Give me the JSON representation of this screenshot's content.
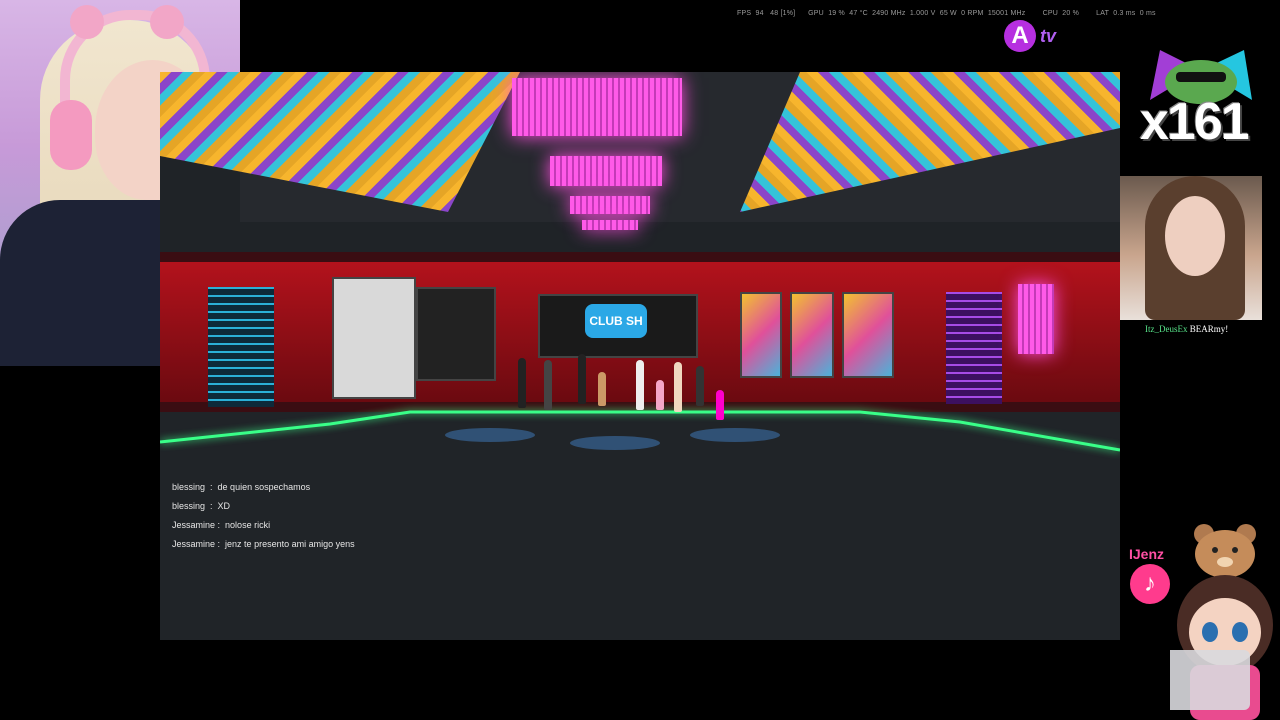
{
  "stream": {
    "stats_overlay": "FPS  94   48 [1%]      GPU  19 %  47 °C  2490 MHz  1.000 V  65 W  0 RPM  15001 MHz        CPU  20 %        LAT  0.3 ms  0 ms",
    "channel_logo": {
      "letter": "A",
      "suffix": "tv",
      "color": "#b62fe0"
    },
    "donation": {
      "multiplier": "x161",
      "emote_icon": "frog-sunglasses-icon"
    },
    "subscriber": {
      "username": "Itz_DeusEx",
      "message": "BEARmy!",
      "name_color": "#57e389"
    },
    "tiktok": {
      "handle": "IJenz",
      "icon": "tiktok-icon",
      "glyph": "♪"
    }
  },
  "game": {
    "club_sign": "CLUB SH",
    "chat": [
      {
        "user": "blessing",
        "text": "de quien sospechamos"
      },
      {
        "user": "blessing",
        "text": "XD"
      },
      {
        "user": "Jessamine",
        "text": "nolose ricki"
      },
      {
        "user": "Jessamine",
        "text": "jenz te presento ami amigo yens"
      }
    ]
  },
  "colors": {
    "neon_green": "#39ff88",
    "neon_pink": "#ff4ee0",
    "wall_red": "#b3121c"
  }
}
